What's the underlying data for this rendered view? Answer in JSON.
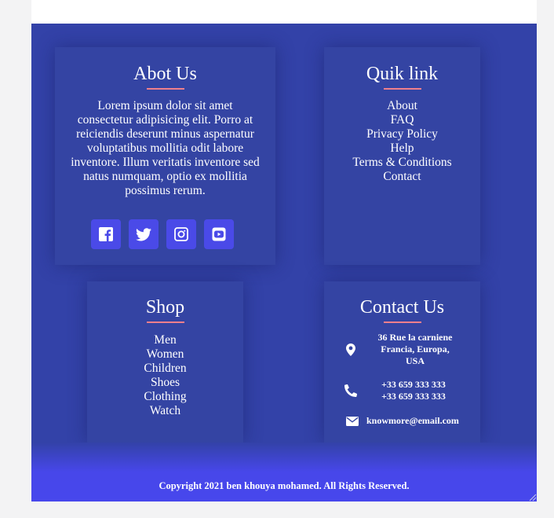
{
  "about": {
    "title": "Abot Us",
    "text": "Lorem ipsum dolor sit amet consectetur adipisicing elit. Porro at reiciendis deserunt minus aspernatur voluptatibus mollitia odit labore inventore. Illum veritatis inventore sed natus numquam, optio ex mollitia possimus rerum.",
    "socials": [
      {
        "icon": "facebook-icon"
      },
      {
        "icon": "twitter-icon"
      },
      {
        "icon": "instagram-icon"
      },
      {
        "icon": "youtube-icon"
      }
    ]
  },
  "quik_link": {
    "title": "Quik link",
    "links": [
      "About",
      "FAQ",
      "Privacy Policy",
      "Help",
      "Terms & Conditions",
      "Contact"
    ]
  },
  "shop": {
    "title": "Shop",
    "links": [
      "Men",
      "Women",
      "Children",
      "Shoes",
      "Clothing",
      "Watch"
    ]
  },
  "contact": {
    "title": "Contact Us",
    "address": [
      "36 Rue la carniene",
      "Francia, Europa,",
      "USA"
    ],
    "phones": [
      "+33 659 333 333",
      "+33 659 333 333"
    ],
    "email": "knowmore@email.com",
    "icons": [
      "map-marker-icon",
      "phone-icon",
      "envelope-icon"
    ]
  },
  "footer": {
    "copyright": "Copyright 2021 ben khouya mohamed. All Rights Reserved."
  },
  "colors": {
    "footer_bg": "#3342a8",
    "card_bg": "#3444a3",
    "accent_underline": "#ef7f8c",
    "social_bg": "#4a4ae8",
    "bottom_bar": "#4747ec",
    "page_bg": "#f3f3f4"
  }
}
